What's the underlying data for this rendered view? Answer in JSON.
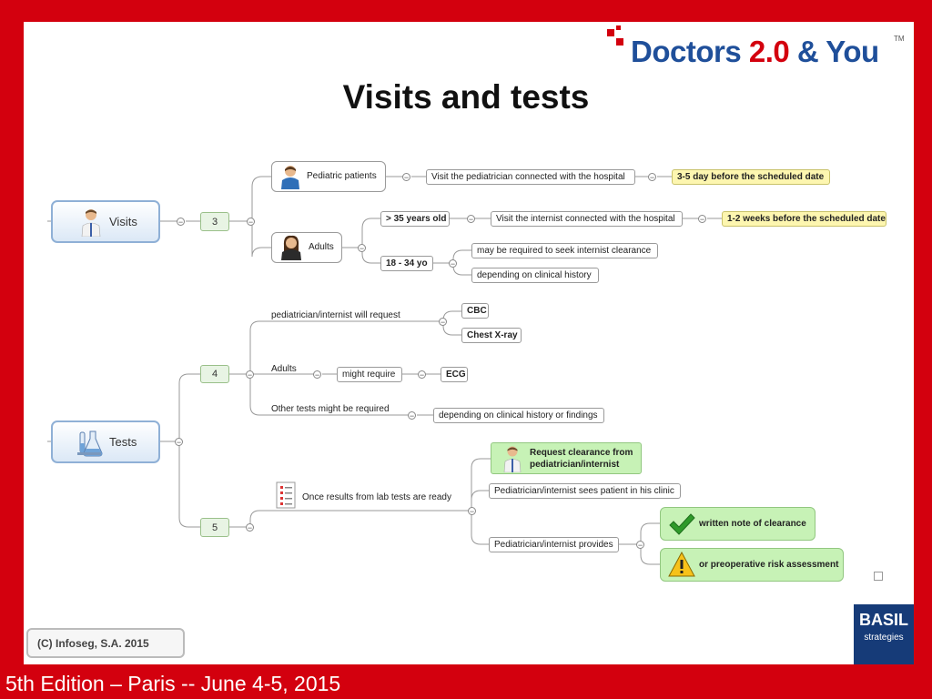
{
  "slide": {
    "title": "Visits and tests",
    "footer": "5th Edition – Paris -- June 4-5, 2015",
    "logo_part1": "Doctors ",
    "logo_part2": "2.0",
    "logo_part3": " & You",
    "logo_tm": "TM",
    "copyright": "(C) Infoseg, S.A. 2015",
    "basil_line1": "BASIL",
    "basil_line2": "strategies"
  },
  "map": {
    "visits": {
      "label": "Visits",
      "count": "3",
      "pediatric": {
        "label": "Pediatric patients",
        "action": "Visit the pediatrician connected with the hospital",
        "timing": "3-5 day before the scheduled date"
      },
      "adults": {
        "label": "Adults",
        "over35": "> 35 years old",
        "over35_action": "Visit the internist connected with the hospital",
        "over35_timing": "1-2 weeks before the scheduled date",
        "range18_34": "18 - 34 yo",
        "range_note1": "may be required to seek internist clearance",
        "range_note2": "depending on clinical history"
      }
    },
    "tests": {
      "label": "Tests",
      "count_a": "4",
      "count_b": "5",
      "request": "pediatrician/internist will request",
      "cbc": "CBC",
      "xray": "Chest X-ray",
      "adults": "Adults",
      "might_require": "might require",
      "ecg": "ECG",
      "other": "Other tests might be required",
      "other_note": "depending on clinical history or findings",
      "results": "Once results from lab tests are ready",
      "clearance": "Request clearance from pediatrician/internist",
      "sees_patient": "Pediatrician/internist sees patient in his clinic",
      "provides": "Pediatrician/internist provides",
      "written_note": "written note of clearance",
      "risk": "or preoperative risk assessment"
    }
  },
  "colors": {
    "frame": "#d3000e",
    "highlight": "#fdf6b0",
    "green_node": "#c7f2b6",
    "root_border": "#8fb0d6",
    "basil_blue": "#163b78"
  }
}
